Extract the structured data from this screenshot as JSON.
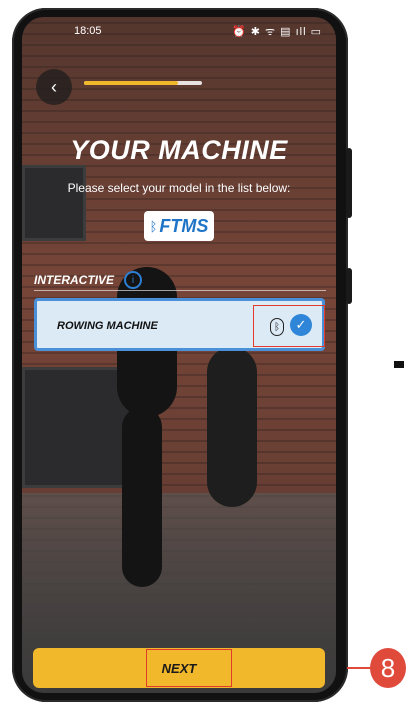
{
  "status_bar": {
    "time": "18:05",
    "icons_text": "⏰ ✱ ᯤ ▤ ıll ▭"
  },
  "header": {
    "back_label": "‹",
    "progress_fraction": 0.8
  },
  "main": {
    "title": "YOUR MACHINE",
    "subtitle": "Please select your model in the list below:",
    "brand_logo_text": "FTMS",
    "section_label": "INTERACTIVE",
    "info_icon_glyph": "i",
    "machines": [
      {
        "name": "ROWING MACHINE",
        "selected": true
      }
    ]
  },
  "footer": {
    "next_label": "NEXT"
  },
  "annotation": {
    "callout_number": "8"
  },
  "colors": {
    "accent": "#f2b82c",
    "selection_blue": "#2f86d8",
    "highlight_red": "#e23b2e"
  }
}
